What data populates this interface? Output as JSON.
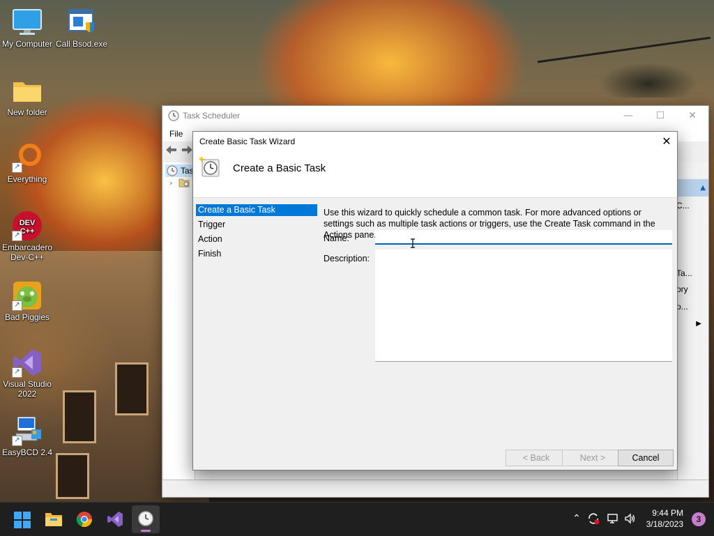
{
  "desktop": {
    "icons": [
      {
        "label": "My Computer"
      },
      {
        "label": "Call Bsod.exe"
      },
      {
        "label": "New folder"
      },
      {
        "label": "Everything"
      },
      {
        "label": "Embarcadero Dev-C++"
      },
      {
        "label": "Bad Piggies"
      },
      {
        "label": "Visual Studio 2022"
      },
      {
        "label": "EasyBCD 2.4"
      }
    ]
  },
  "task_scheduler": {
    "title": "Task Scheduler",
    "menu_file": "File",
    "tree_item": "Task",
    "right_pane": {
      "item_1": "C...",
      "item_2": "Ta...",
      "item_3": "ory",
      "item_4": "o..."
    }
  },
  "wizard": {
    "title": "Create Basic Task Wizard",
    "header_title": "Create a Basic Task",
    "steps": [
      {
        "label": "Create a Basic Task",
        "active": true
      },
      {
        "label": "Trigger",
        "active": false
      },
      {
        "label": "Action",
        "active": false
      },
      {
        "label": "Finish",
        "active": false
      }
    ],
    "intro_text": "Use this wizard to quickly schedule a common task.  For more advanced options or settings such as multiple task actions or triggers, use the Create Task command in the Actions pane.",
    "name_label": "Name:",
    "name_value": "",
    "description_label": "Description:",
    "description_value": "",
    "buttons": {
      "back": "< Back",
      "next": "Next >",
      "cancel": "Cancel"
    }
  },
  "taskbar": {
    "apps": [
      "start-icon",
      "file-explorer-icon",
      "chrome-icon",
      "visual-studio-icon",
      "task-scheduler-icon"
    ],
    "clock_time": "9:44 PM",
    "clock_date": "3/18/2023",
    "notification_count": "3"
  }
}
